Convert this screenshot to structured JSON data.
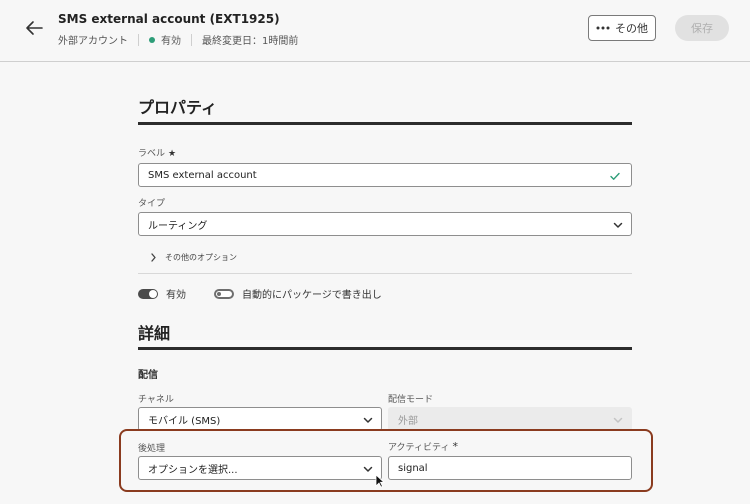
{
  "header": {
    "title": "SMS external account (EXT1925)",
    "type": "外部アカウント",
    "status": "有効",
    "last_modified": "最終変更日：1時間前",
    "more_label": "その他",
    "save_label": "保存"
  },
  "properties": {
    "title": "プロパティ",
    "label_field_label": "ラベル",
    "label_field_value": "SMS external account",
    "type_field_label": "タイプ",
    "type_field_value": "ルーティング",
    "more_options": "その他のオプション",
    "toggle_enabled_label": "有効",
    "toggle_export_label": "自動的にパッケージで書き出し"
  },
  "details": {
    "title": "詳細",
    "delivery_title": "配信",
    "channel_label": "チャネル",
    "channel_value": "モバイル (SMS)",
    "delivery_mode_label": "配信モード",
    "delivery_mode_value": "外部",
    "post_processing_label": "後処理",
    "post_processing_placeholder": "オプションを選択...",
    "activity_label": "アクティビティ",
    "activity_value": "signal"
  },
  "colors": {
    "status_green": "#2d9d78",
    "highlight_border": "#8a3b1f"
  },
  "icons": [
    "back-arrow-icon",
    "more-dots-icon",
    "check-icon",
    "chevron-down-icon",
    "chevron-right-icon",
    "cursor-icon"
  ]
}
